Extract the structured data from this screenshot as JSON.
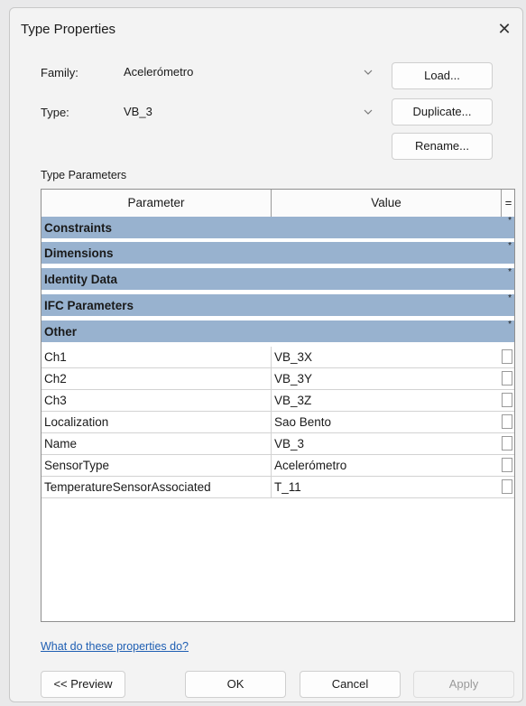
{
  "window": {
    "title": "Type Properties",
    "close_glyph": "✕"
  },
  "family": {
    "label": "Family:",
    "value": "Acelerómetro"
  },
  "type": {
    "label": "Type:",
    "value": "VB_3"
  },
  "buttons": {
    "load": "Load...",
    "duplicate": "Duplicate...",
    "rename": "Rename..."
  },
  "type_parameters": {
    "label": "Type Parameters",
    "columns": {
      "parameter": "Parameter",
      "value": "Value",
      "extra": "="
    },
    "groups": [
      {
        "name": "Constraints"
      },
      {
        "name": "Dimensions"
      },
      {
        "name": "Identity Data"
      },
      {
        "name": "IFC Parameters"
      },
      {
        "name": "Other"
      }
    ],
    "rows": [
      {
        "parameter": "Ch1",
        "value": "VB_3X"
      },
      {
        "parameter": "Ch2",
        "value": "VB_3Y"
      },
      {
        "parameter": "Ch3",
        "value": "VB_3Z"
      },
      {
        "parameter": "Localization",
        "value": "Sao Bento"
      },
      {
        "parameter": "Name",
        "value": "VB_3"
      },
      {
        "parameter": "SensorType",
        "value": "Acelerómetro"
      },
      {
        "parameter": "TemperatureSensorAssociated",
        "value": "T_11"
      }
    ]
  },
  "help_link": "What do these properties do?",
  "footer": {
    "preview": "<< Preview",
    "ok": "OK",
    "cancel": "Cancel",
    "apply": "Apply"
  },
  "colors": {
    "group_header": "#98b2cf",
    "link": "#1f5fb3"
  }
}
